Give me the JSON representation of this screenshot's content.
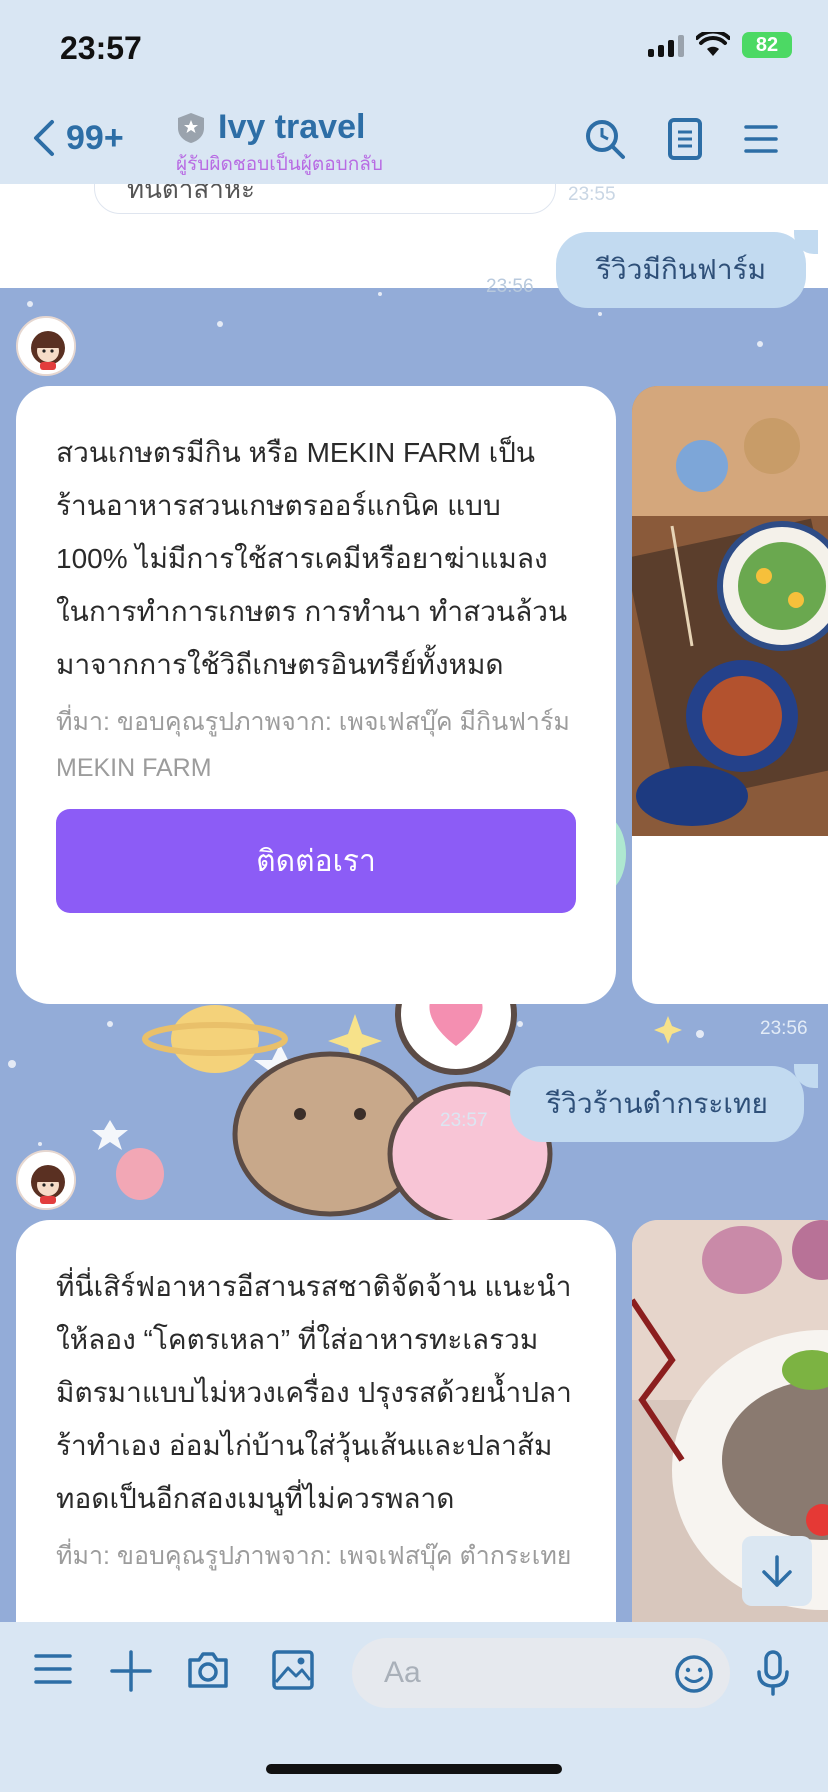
{
  "status": {
    "time": "23:57",
    "battery": "82"
  },
  "header": {
    "back_count": "99+",
    "title": "Ivy travel",
    "subtitle": "ผู้รับผิดชอบเป็นผู้ตอบกลับ"
  },
  "messages": {
    "old_fragment": "ทันต้าสาหะ",
    "time_1": "23:55",
    "sent_1": "รีวิวมีกินฟาร์ม",
    "time_2": "23:56",
    "card_1": {
      "body": "สวนเกษตรมีกิน หรือ MEKIN FARM เป็นร้านอาหารสวนเกษตรออร์แกนิค แบบ 100% ไม่มีการใช้สารเคมีหรือยาฆ่าแมลงในการทำการเกษตร การทำนา ทำสวนล้วนมาจากการใช้วิถีเกษตรอินทรีย์ทั้งหมด",
      "source": "ที่มา: ขอบคุณรูปภาพจาก: เพจเฟสบุ๊ค มีกินฟาร์ม MEKIN FARM",
      "button": "ติดต่อเรา"
    },
    "time_3": "23:56",
    "sent_2": "รีวิวร้านตำกระเทย",
    "time_4": "23:57",
    "card_2": {
      "body": "ที่นี่เสิร์ฟอาหารอีสานรสชาติจัดจ้าน แนะนำให้ลอง “โคตรเหลา” ที่ใส่อาหารทะเลรวมมิตรมาแบบไม่หวงเครื่อง ปรุงรสด้วยน้ำปลาร้าทำเอง อ่อมไก่บ้านใส่วุ้นเส้นและปลาส้มทอดเป็นอีกสองเมนูที่ไม่ควรพลาด",
      "source": "ที่มา: ขอบคุณรูปภาพจาก: เพจเฟสบุ๊ค ตำกระเทย"
    }
  },
  "input": {
    "placeholder": "Aa"
  },
  "colors": {
    "accent": "#2d6ea6",
    "button": "#8c5cf6",
    "chat_bg": "#93acd8",
    "sent_bubble": "#c2daf0"
  }
}
